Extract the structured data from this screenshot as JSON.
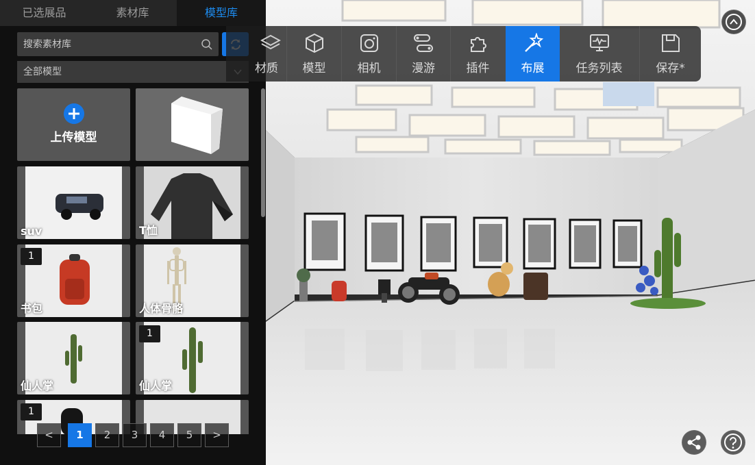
{
  "panel": {
    "tabs": [
      {
        "label": "已选展品"
      },
      {
        "label": "素材库"
      },
      {
        "label": "模型库"
      }
    ],
    "search": {
      "placeholder": "搜索素材库"
    },
    "filter": {
      "selected": "全部模型"
    },
    "upload": {
      "label": "上传模型"
    },
    "cards": [
      {
        "label": "suv",
        "badge": ""
      },
      {
        "label": "T恤",
        "badge": ""
      },
      {
        "label": "书包",
        "badge": "1"
      },
      {
        "label": "人体骨骼",
        "badge": ""
      },
      {
        "label": "仙人掌",
        "badge": ""
      },
      {
        "label": "仙人掌",
        "badge": "1"
      },
      {
        "label": "",
        "badge": "1"
      }
    ],
    "pagination": {
      "prev": "<",
      "pages": [
        "1",
        "2",
        "3",
        "4",
        "5"
      ],
      "next": ">",
      "current": "1"
    }
  },
  "toolbar": {
    "items": [
      {
        "label": "材质",
        "icon": "layers-icon"
      },
      {
        "label": "模型",
        "icon": "cube-icon"
      },
      {
        "label": "相机",
        "icon": "camera-icon"
      },
      {
        "label": "漫游",
        "icon": "route-icon"
      },
      {
        "label": "插件",
        "icon": "puzzle-icon"
      },
      {
        "label": "布展",
        "icon": "magic-wand-icon"
      },
      {
        "label": "任务列表",
        "icon": "monitor-icon"
      },
      {
        "label": "保存*",
        "icon": "save-icon"
      }
    ],
    "active": "布展"
  },
  "colors": {
    "accent": "#1677e6",
    "active_tab_text": "#1d8cf0"
  }
}
